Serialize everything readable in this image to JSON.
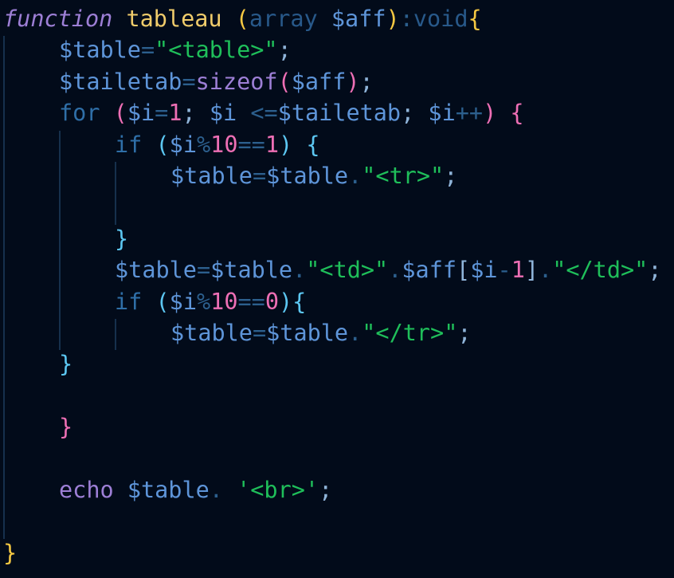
{
  "colors": {
    "background": "#020b1a",
    "indent_guide": "#16304d",
    "keyword": "#9d7fd6",
    "keyword_flow": "#2f6fa8",
    "function_name": "#f0cc6b",
    "type": "#28598a",
    "variable": "#5e95d9",
    "string": "#1fbf5a",
    "number": "#ee6fb5",
    "operator": "#2c5f8d",
    "brace_outer": "#f5c842",
    "brace_mid": "#ee6fb5",
    "brace_inner": "#5cc7f2",
    "punctuation": "#8fb4d9",
    "plain": "#5e95d9"
  },
  "code": {
    "language": "PHP",
    "lines": [
      {
        "indent": 0,
        "tokens": [
          {
            "t": "function",
            "k": "keyword",
            "italic": true
          },
          {
            "t": " ",
            "k": "plain"
          },
          {
            "t": "tableau",
            "k": "function_name"
          },
          {
            "t": " ",
            "k": "plain"
          },
          {
            "t": "(",
            "k": "brace_outer"
          },
          {
            "t": "array",
            "k": "type"
          },
          {
            "t": " ",
            "k": "plain"
          },
          {
            "t": "$aff",
            "k": "variable"
          },
          {
            "t": ")",
            "k": "brace_outer"
          },
          {
            "t": ":",
            "k": "operator"
          },
          {
            "t": "void",
            "k": "type"
          },
          {
            "t": "{",
            "k": "brace_outer"
          }
        ]
      },
      {
        "indent": 1,
        "tokens": [
          {
            "t": "$table",
            "k": "variable"
          },
          {
            "t": "=",
            "k": "operator"
          },
          {
            "t": "\"<table>\"",
            "k": "string"
          },
          {
            "t": ";",
            "k": "punctuation"
          }
        ]
      },
      {
        "indent": 1,
        "tokens": [
          {
            "t": "$tailetab",
            "k": "variable"
          },
          {
            "t": "=",
            "k": "operator"
          },
          {
            "t": "sizeof",
            "k": "keyword"
          },
          {
            "t": "(",
            "k": "brace_mid"
          },
          {
            "t": "$aff",
            "k": "variable"
          },
          {
            "t": ")",
            "k": "brace_mid"
          },
          {
            "t": ";",
            "k": "punctuation"
          }
        ]
      },
      {
        "indent": 1,
        "tokens": [
          {
            "t": "for",
            "k": "keyword_flow"
          },
          {
            "t": " ",
            "k": "plain"
          },
          {
            "t": "(",
            "k": "brace_mid"
          },
          {
            "t": "$i",
            "k": "variable"
          },
          {
            "t": "=",
            "k": "operator"
          },
          {
            "t": "1",
            "k": "number"
          },
          {
            "t": "; ",
            "k": "punctuation"
          },
          {
            "t": "$i",
            "k": "variable"
          },
          {
            "t": " ",
            "k": "plain"
          },
          {
            "t": "<=",
            "k": "operator"
          },
          {
            "t": "$tailetab",
            "k": "variable"
          },
          {
            "t": "; ",
            "k": "punctuation"
          },
          {
            "t": "$i",
            "k": "variable"
          },
          {
            "t": "++",
            "k": "operator"
          },
          {
            "t": ")",
            "k": "brace_mid"
          },
          {
            "t": " ",
            "k": "plain"
          },
          {
            "t": "{",
            "k": "brace_mid"
          }
        ]
      },
      {
        "indent": 2,
        "tokens": [
          {
            "t": "if",
            "k": "keyword_flow"
          },
          {
            "t": " ",
            "k": "plain"
          },
          {
            "t": "(",
            "k": "brace_inner"
          },
          {
            "t": "$i",
            "k": "variable"
          },
          {
            "t": "%",
            "k": "operator"
          },
          {
            "t": "10",
            "k": "number"
          },
          {
            "t": "==",
            "k": "operator"
          },
          {
            "t": "1",
            "k": "number"
          },
          {
            "t": ")",
            "k": "brace_inner"
          },
          {
            "t": " ",
            "k": "plain"
          },
          {
            "t": "{",
            "k": "brace_inner"
          }
        ]
      },
      {
        "indent": 3,
        "tokens": [
          {
            "t": "$table",
            "k": "variable"
          },
          {
            "t": "=",
            "k": "operator"
          },
          {
            "t": "$table",
            "k": "variable"
          },
          {
            "t": ".",
            "k": "operator"
          },
          {
            "t": "\"<tr>\"",
            "k": "string"
          },
          {
            "t": ";",
            "k": "punctuation"
          }
        ]
      },
      {
        "indent": 3,
        "tokens": []
      },
      {
        "indent": 2,
        "tokens": [
          {
            "t": "}",
            "k": "brace_inner"
          }
        ]
      },
      {
        "indent": 2,
        "tokens": [
          {
            "t": "$table",
            "k": "variable"
          },
          {
            "t": "=",
            "k": "operator"
          },
          {
            "t": "$table",
            "k": "variable"
          },
          {
            "t": ".",
            "k": "operator"
          },
          {
            "t": "\"<td>\"",
            "k": "string"
          },
          {
            "t": ".",
            "k": "operator"
          },
          {
            "t": "$aff",
            "k": "variable"
          },
          {
            "t": "[",
            "k": "punctuation"
          },
          {
            "t": "$i",
            "k": "variable"
          },
          {
            "t": "-",
            "k": "operator"
          },
          {
            "t": "1",
            "k": "number"
          },
          {
            "t": "]",
            "k": "punctuation"
          },
          {
            "t": ".",
            "k": "operator"
          },
          {
            "t": "\"</td>\"",
            "k": "string"
          },
          {
            "t": ";",
            "k": "punctuation"
          }
        ]
      },
      {
        "indent": 2,
        "tokens": [
          {
            "t": "if",
            "k": "keyword_flow"
          },
          {
            "t": " ",
            "k": "plain"
          },
          {
            "t": "(",
            "k": "brace_inner"
          },
          {
            "t": "$i",
            "k": "variable"
          },
          {
            "t": "%",
            "k": "operator"
          },
          {
            "t": "10",
            "k": "number"
          },
          {
            "t": "==",
            "k": "operator"
          },
          {
            "t": "0",
            "k": "number"
          },
          {
            "t": ")",
            "k": "brace_inner"
          },
          {
            "t": "{",
            "k": "brace_inner"
          }
        ]
      },
      {
        "indent": 3,
        "tokens": [
          {
            "t": "$table",
            "k": "variable"
          },
          {
            "t": "=",
            "k": "operator"
          },
          {
            "t": "$table",
            "k": "variable"
          },
          {
            "t": ".",
            "k": "operator"
          },
          {
            "t": "\"</tr>\"",
            "k": "string"
          },
          {
            "t": ";",
            "k": "punctuation"
          }
        ]
      },
      {
        "indent": 1,
        "tokens": [
          {
            "t": "}",
            "k": "brace_inner"
          }
        ]
      },
      {
        "indent": 1,
        "tokens": []
      },
      {
        "indent": 1,
        "tokens": [
          {
            "t": "}",
            "k": "brace_mid"
          }
        ]
      },
      {
        "indent": 1,
        "tokens": []
      },
      {
        "indent": 1,
        "tokens": [
          {
            "t": "echo",
            "k": "keyword"
          },
          {
            "t": " ",
            "k": "plain"
          },
          {
            "t": "$table",
            "k": "variable"
          },
          {
            "t": ".",
            "k": "operator"
          },
          {
            "t": " ",
            "k": "plain"
          },
          {
            "t": "'<br>'",
            "k": "string"
          },
          {
            "t": ";",
            "k": "punctuation"
          }
        ]
      },
      {
        "indent": 1,
        "tokens": []
      },
      {
        "indent": 0,
        "tokens": [
          {
            "t": "}",
            "k": "brace_outer"
          }
        ]
      }
    ]
  }
}
